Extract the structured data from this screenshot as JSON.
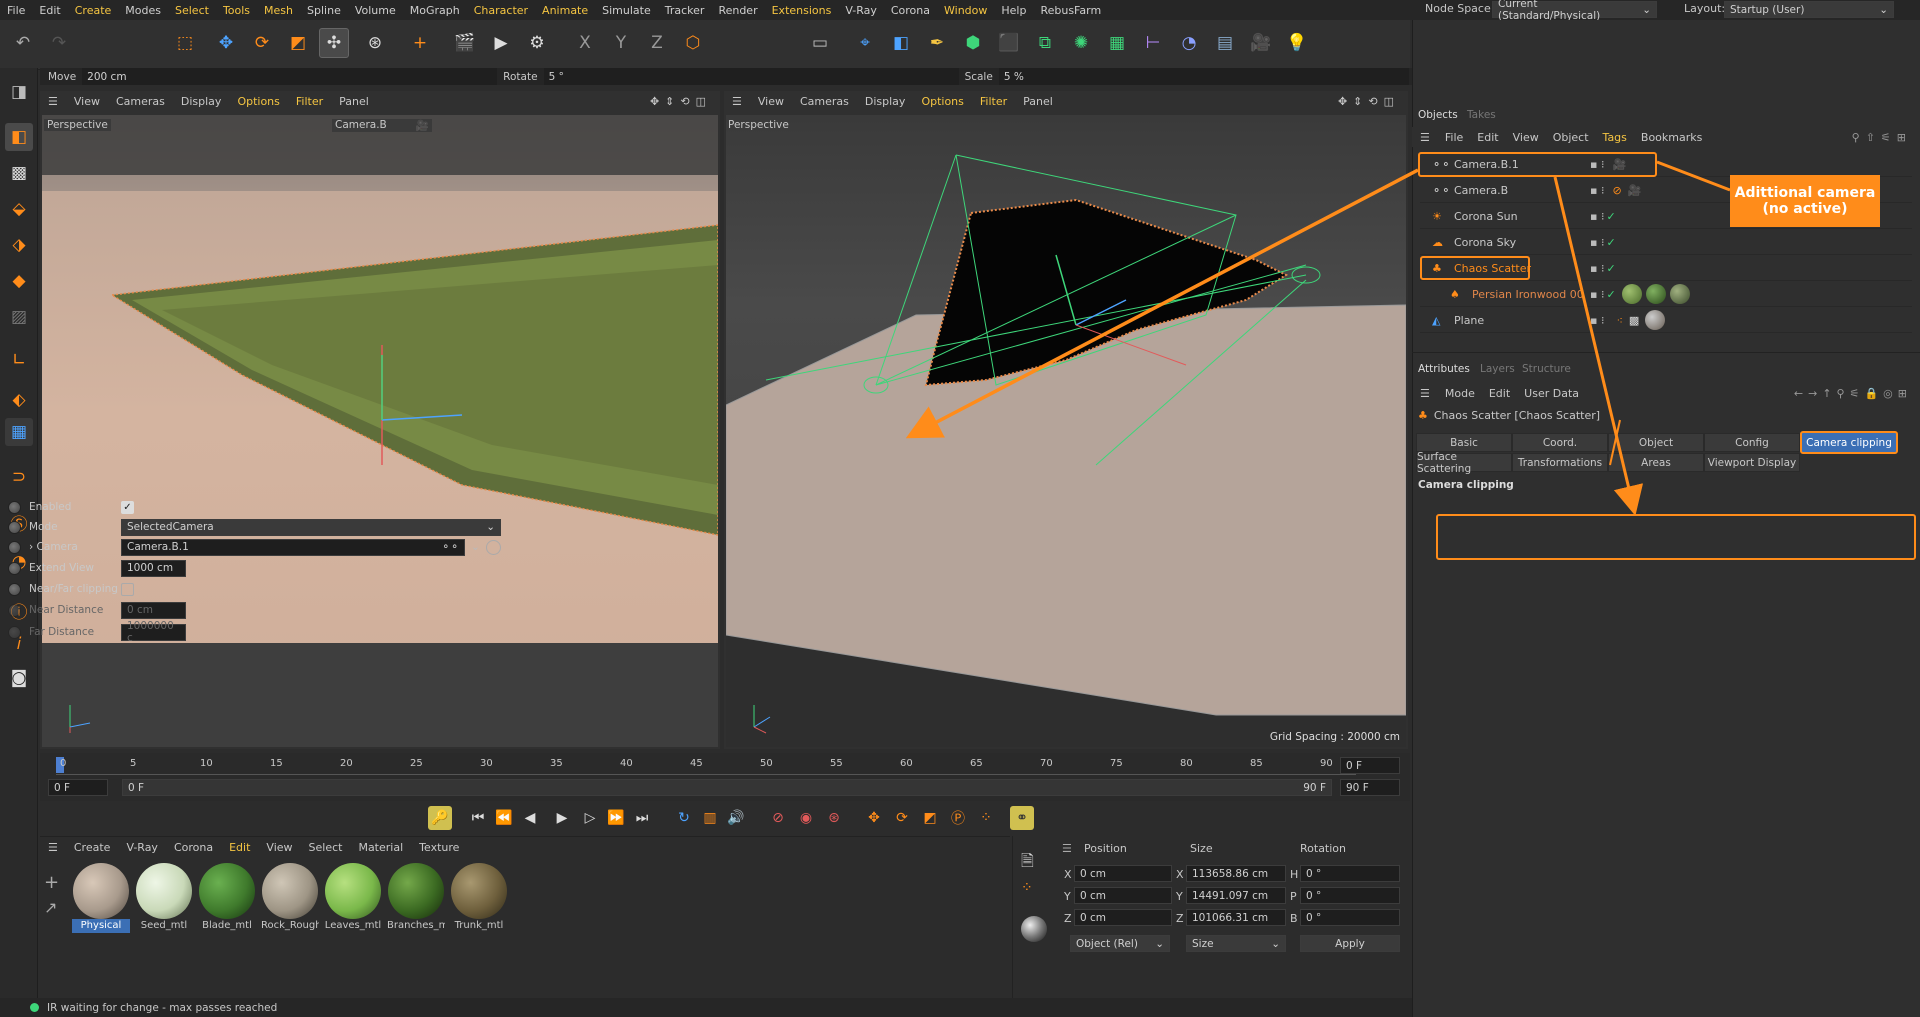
{
  "menubar": {
    "items": [
      "File",
      "Edit",
      "Create",
      "Modes",
      "Select",
      "Tools",
      "Mesh",
      "Spline",
      "Volume",
      "MoGraph",
      "Character",
      "Animate",
      "Simulate",
      "Tracker",
      "Render",
      "Extensions",
      "V-Ray",
      "Corona",
      "Window",
      "Help",
      "RebusFarm"
    ],
    "node_space_label": "Node Space:",
    "node_space_value": "Current (Standard/Physical)",
    "layout_label": "Layout:",
    "layout_value": "Startup (User)"
  },
  "coordbar": {
    "move_label": "Move",
    "move_value": "200 cm",
    "rotate_label": "Rotate",
    "rotate_value": "5 °",
    "scale_label": "Scale",
    "scale_value": "5 %"
  },
  "viewport_left": {
    "menu": [
      "View",
      "Cameras",
      "Display",
      "Options",
      "Filter",
      "Panel"
    ],
    "label": "Perspective",
    "camera": "Camera.B"
  },
  "viewport_right": {
    "menu": [
      "View",
      "Cameras",
      "Display",
      "Options",
      "Filter",
      "Panel"
    ],
    "label": "Perspective",
    "grid_spacing": "Grid Spacing : 20000 cm"
  },
  "timeline": {
    "ticks": [
      "0",
      "5",
      "10",
      "15",
      "20",
      "25",
      "30",
      "35",
      "40",
      "45",
      "50",
      "55",
      "60",
      "65",
      "70",
      "75",
      "80",
      "85",
      "90"
    ],
    "current_frame": "0 F",
    "start": "0 F",
    "range_start": "0 F",
    "range_end": "90 F",
    "end": "90 F"
  },
  "material_menu": [
    "Create",
    "V-Ray",
    "Corona",
    "Edit",
    "View",
    "Select",
    "Material",
    "Texture"
  ],
  "materials": [
    {
      "name": "Physical",
      "color": "#a89a8c"
    },
    {
      "name": "Seed_mtl",
      "color": "#c9d9b8"
    },
    {
      "name": "Blade_mtl",
      "color": "#3f7a2c"
    },
    {
      "name": "Rock_Rough",
      "color": "#9e9585"
    },
    {
      "name": "Leaves_mtl",
      "color": "#7ab84a"
    },
    {
      "name": "Branches_m",
      "color": "#3b6a22"
    },
    {
      "name": "Trunk_mtl",
      "color": "#6e5f3c"
    }
  ],
  "transform": {
    "headers": [
      "Position",
      "Size",
      "Rotation"
    ],
    "rows": [
      {
        "axis": "X",
        "pos": "0 cm",
        "saxis": "X",
        "size": "113658.86 cm",
        "raxis": "H",
        "rot": "0 °"
      },
      {
        "axis": "Y",
        "pos": "0 cm",
        "saxis": "Y",
        "size": "14491.097 cm",
        "raxis": "P",
        "rot": "0 °"
      },
      {
        "axis": "Z",
        "pos": "0 cm",
        "saxis": "Z",
        "size": "101066.31 cm",
        "raxis": "B",
        "rot": "0 °"
      }
    ],
    "mode": "Object (Rel)",
    "size_mode": "Size",
    "apply": "Apply"
  },
  "status": "IR waiting for change - max passes reached",
  "objects_panel": {
    "tabs": [
      "Objects",
      "Takes"
    ],
    "menu": [
      "File",
      "Edit",
      "View",
      "Object",
      "Tags",
      "Bookmarks"
    ],
    "items": [
      {
        "name": "Camera.B.1",
        "icon": "camera-icon"
      },
      {
        "name": "Camera.B",
        "icon": "camera-icon"
      },
      {
        "name": "Corona Sun",
        "icon": "sun-icon"
      },
      {
        "name": "Corona Sky",
        "icon": "sky-icon"
      },
      {
        "name": "Chaos Scatter",
        "icon": "scatter-icon"
      },
      {
        "name": "Persian Ironwood 002",
        "icon": "tree-icon"
      },
      {
        "name": "Plane",
        "icon": "plane-icon"
      }
    ]
  },
  "annotation": {
    "line1": "Adittional camera",
    "line2": "(no active)"
  },
  "attributes": {
    "tabs": [
      "Attributes",
      "Layers",
      "Structure"
    ],
    "menu": [
      "Mode",
      "Edit",
      "User Data"
    ],
    "title": "Chaos Scatter [Chaos Scatter]",
    "tabs_row1": [
      "Basic",
      "Coord.",
      "Object",
      "Config",
      "Camera clipping"
    ],
    "tabs_row2": [
      "Surface Scattering",
      "Transformations",
      "Areas",
      "Viewport Display"
    ],
    "section": "Camera clipping",
    "enabled_label": "Enabled",
    "mode_label": "Mode",
    "mode_value": "SelectedCamera",
    "camera_label": "Camera",
    "camera_value": "Camera.B.1",
    "extend_label": "Extend View",
    "extend_value": "1000 cm",
    "nearfar_label": "Near/Far clipping",
    "near_label": "Near Distance",
    "near_value": "0 cm",
    "far_label": "Far Distance",
    "far_value": "1000000 c"
  },
  "colors": {
    "accent": "#ff8c1a",
    "highlight": "#f5c542",
    "selection": "#3b6fb5"
  }
}
